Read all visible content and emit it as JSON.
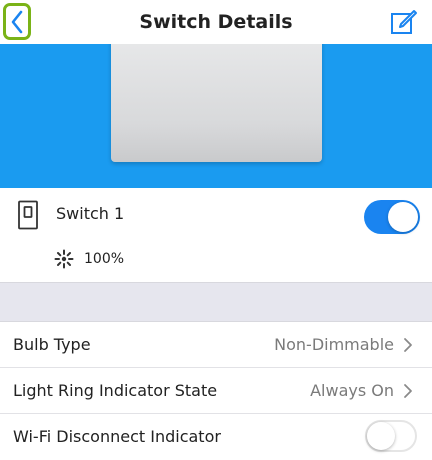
{
  "header": {
    "title": "Switch Details",
    "back_icon": "chevron-left-icon",
    "edit_icon": "edit-icon"
  },
  "device": {
    "name": "Switch 1",
    "power_on": true,
    "brightness": "100%",
    "brightness_icon": "brightness-icon",
    "device_icon": "switch-device-icon"
  },
  "settings": [
    {
      "label": "Bulb Type",
      "value": "Non-Dimmable"
    },
    {
      "label": "Light Ring Indicator State",
      "value": "Always On"
    },
    {
      "label": "Wi-Fi Disconnect Indicator",
      "toggle": false
    }
  ],
  "colors": {
    "accent": "#1a84f0",
    "banner": "#1a9bf0",
    "highlight": "#7ab317"
  }
}
